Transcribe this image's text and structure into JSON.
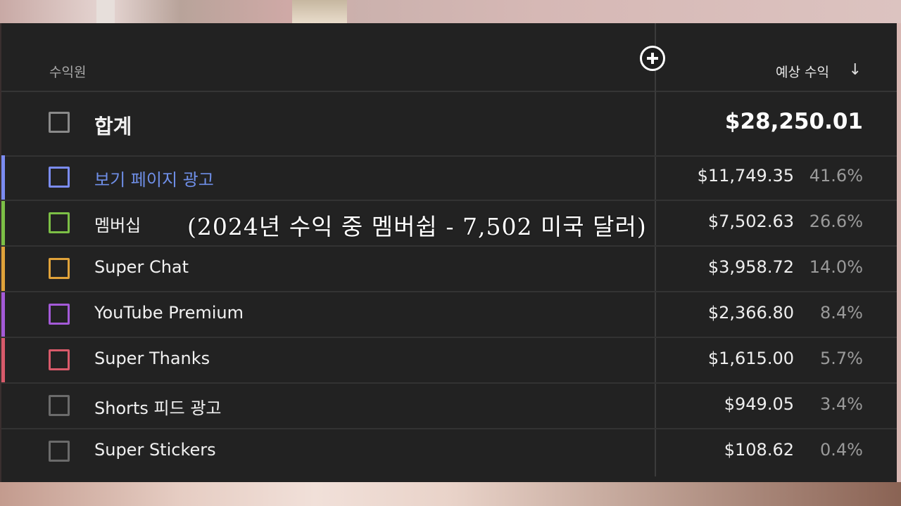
{
  "table": {
    "column_label": "수익원",
    "sort_label": "예상 수익",
    "sort_icon": "↓",
    "total": {
      "label": "합계",
      "amount": "$28,250.01"
    },
    "rows": [
      {
        "label": "보기 페이지 광고",
        "amount": "$11,749.35",
        "percent": "41.6%",
        "color": "#7b8cf2",
        "label_color": "#6f8fe8"
      },
      {
        "label": "멤버십",
        "amount": "$7,502.63",
        "percent": "26.6%",
        "color": "#7cbf46",
        "label_color": "#f1f1f1"
      },
      {
        "label": "Super Chat",
        "amount": "$3,958.72",
        "percent": "14.0%",
        "color": "#e0a23a",
        "label_color": "#f1f1f1"
      },
      {
        "label": "YouTube Premium",
        "amount": "$2,366.80",
        "percent": "8.4%",
        "color": "#a45ad8",
        "label_color": "#f1f1f1"
      },
      {
        "label": "Super Thanks",
        "amount": "$1,615.00",
        "percent": "5.7%",
        "color": "#d85a6a",
        "label_color": "#f1f1f1"
      },
      {
        "label": "Shorts 피드 광고",
        "amount": "$949.05",
        "percent": "3.4%",
        "color": "#6b6b6b",
        "label_color": "#f1f1f1"
      },
      {
        "label": "Super Stickers",
        "amount": "$108.62",
        "percent": "0.4%",
        "color": "#6b6b6b",
        "label_color": "#f1f1f1"
      }
    ]
  },
  "caption": "(2024년 수익 중 멤버쉽 - 7,502 미국 달러)"
}
